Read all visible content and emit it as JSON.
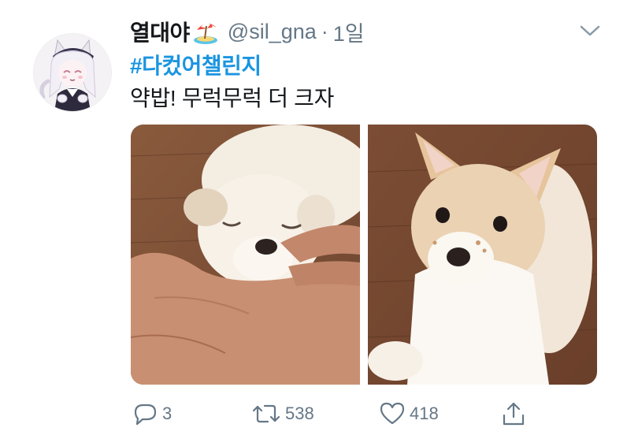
{
  "tweet": {
    "display_name": "열대야",
    "name_emoji": "beach-umbrella-emoji",
    "handle": "@sil_gna",
    "separator": "·",
    "time": "1일",
    "hashtag": "#다컸어챌린지",
    "text": "약밥! 무럭무럭 더 크자"
  },
  "media": {
    "photos": [
      {
        "subject": "puppy-asleep-on-hand"
      },
      {
        "subject": "grown-dog-lying-on-floor"
      }
    ]
  },
  "actions": {
    "reply_count": "3",
    "retweet_count": "538",
    "like_count": "418"
  },
  "icons": {
    "reply": "speech-bubble-icon",
    "retweet": "retweet-arrows-icon",
    "like": "heart-outline-icon",
    "share": "share-upload-icon",
    "more": "chevron-down-icon"
  },
  "colors": {
    "text": "#14171a",
    "secondary": "#657786",
    "hashtag": "#1b95e0",
    "background": "#ffffff"
  }
}
